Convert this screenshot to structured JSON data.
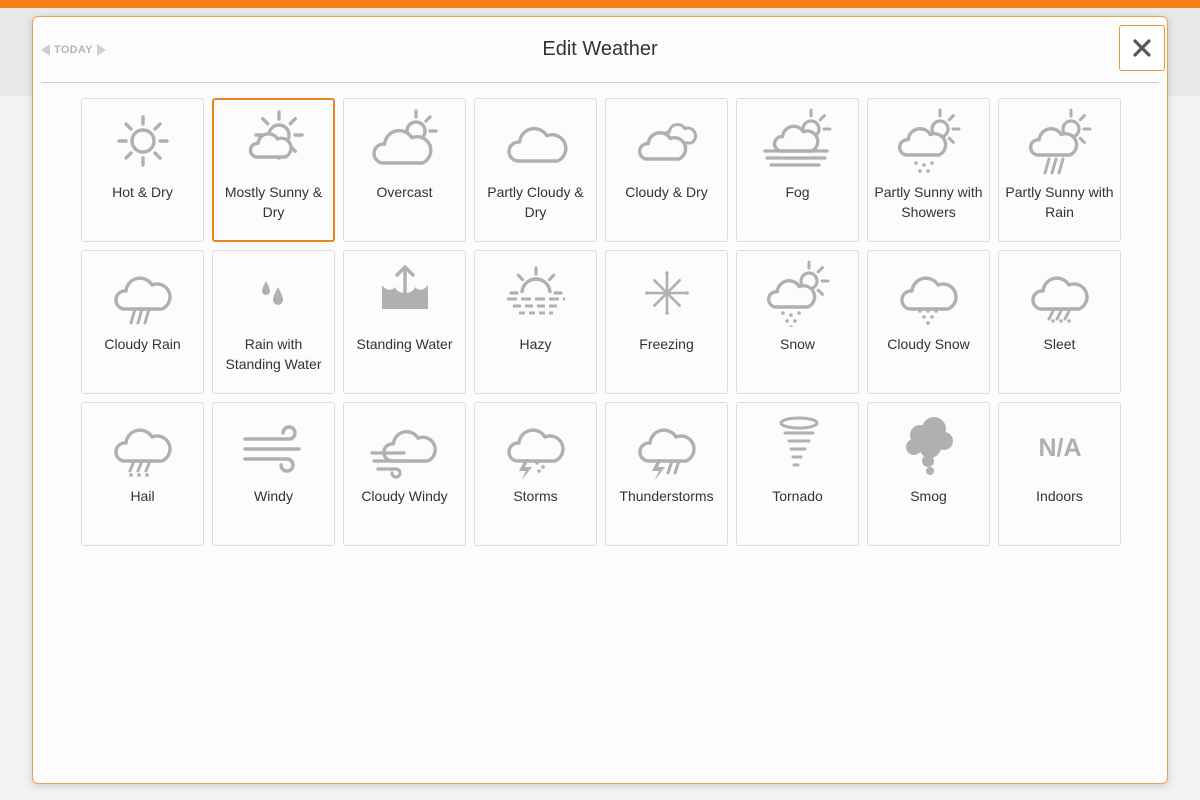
{
  "dialog": {
    "title": "Edit Weather",
    "today_label": "TODAY",
    "accent_color": "#f57f17",
    "selected": "Mostly Sunny & Dry"
  },
  "icons": {
    "prev": "triangle-left-icon",
    "next": "triangle-right-icon",
    "close": "close-icon"
  },
  "tiles": [
    {
      "label": "Hot & Dry",
      "icon": "sun"
    },
    {
      "label": "Mostly Sunny & Dry",
      "icon": "sun-cloud"
    },
    {
      "label": "Overcast",
      "icon": "cloud-sun-big"
    },
    {
      "label": "Partly Cloudy & Dry",
      "icon": "cloud"
    },
    {
      "label": "Cloudy & Dry",
      "icon": "clouds"
    },
    {
      "label": "Fog",
      "icon": "fog"
    },
    {
      "label": "Partly Sunny with Showers",
      "icon": "sun-cloud-showers"
    },
    {
      "label": "Partly Sunny with Rain",
      "icon": "sun-cloud-rain"
    },
    {
      "label": "Cloudy Rain",
      "icon": "cloud-rain"
    },
    {
      "label": "Rain with Standing Water",
      "icon": "drops"
    },
    {
      "label": "Standing Water",
      "icon": "standing-water"
    },
    {
      "label": "Hazy",
      "icon": "hazy"
    },
    {
      "label": "Freezing",
      "icon": "snowflake"
    },
    {
      "label": "Snow",
      "icon": "sun-cloud-snow"
    },
    {
      "label": "Cloudy Snow",
      "icon": "cloud-snow"
    },
    {
      "label": "Sleet",
      "icon": "cloud-sleet"
    },
    {
      "label": "Hail",
      "icon": "cloud-hail"
    },
    {
      "label": "Windy",
      "icon": "wind"
    },
    {
      "label": "Cloudy Windy",
      "icon": "cloud-wind"
    },
    {
      "label": "Storms",
      "icon": "cloud-storm"
    },
    {
      "label": "Thunderstorms",
      "icon": "cloud-thunderstorm"
    },
    {
      "label": "Tornado",
      "icon": "tornado"
    },
    {
      "label": "Smog",
      "icon": "smog"
    },
    {
      "label": "Indoors",
      "icon": "na",
      "icon_text": "N/A"
    }
  ]
}
